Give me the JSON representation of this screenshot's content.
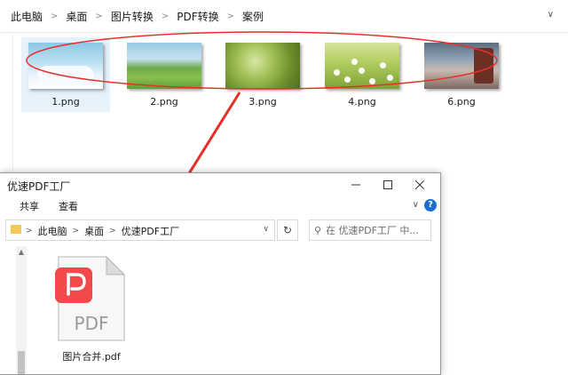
{
  "background_explorer": {
    "breadcrumb": [
      "此电脑",
      "桌面",
      "图片转换",
      "PDF转换",
      "案例"
    ],
    "files": [
      {
        "name": "1.png",
        "selected": true
      },
      {
        "name": "2.png",
        "selected": false
      },
      {
        "name": "3.png",
        "selected": false
      },
      {
        "name": "4.png",
        "selected": false
      },
      {
        "name": "6.png",
        "selected": false
      }
    ]
  },
  "dialog": {
    "title": "优速PDF工厂",
    "menu": [
      "共享",
      "查看"
    ],
    "breadcrumb": [
      "此电脑",
      "桌面",
      "优速PDF工厂"
    ],
    "search_placeholder": "在 优速PDF工厂 中...",
    "file": {
      "name": "图片合并.pdf",
      "icon_text": "PDF"
    }
  },
  "colors": {
    "annotation_red": "#e8302a",
    "pdf_badge_red": "#f24a4a",
    "selection_blue": "#e5f1fb",
    "folder_yellow": "#f2c85a"
  }
}
